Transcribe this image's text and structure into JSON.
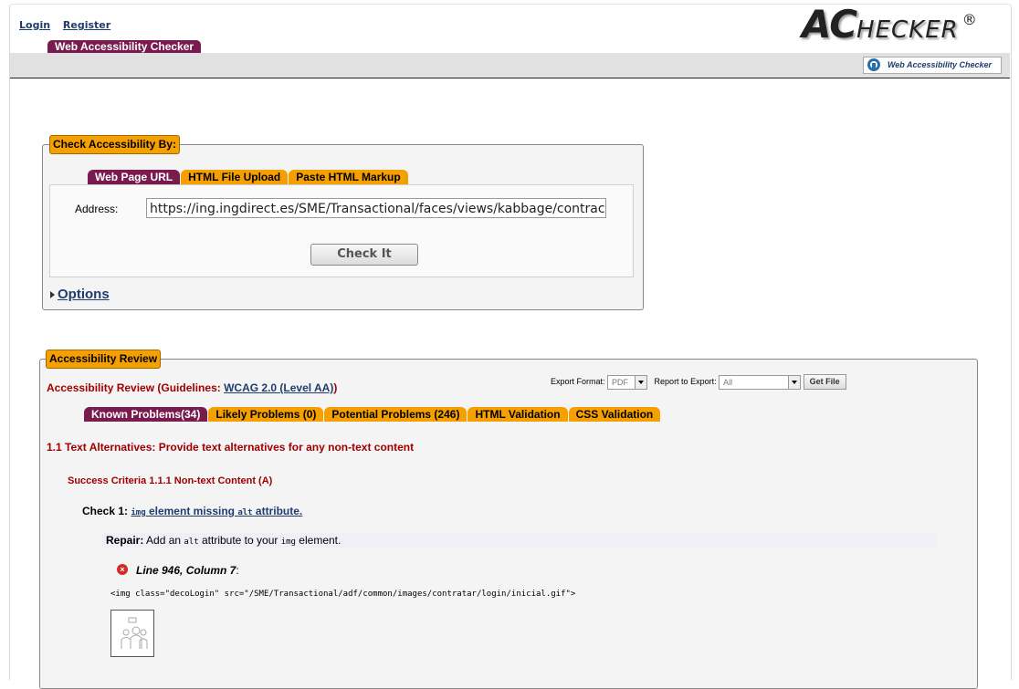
{
  "header": {
    "login": "Login",
    "register": "Register",
    "logo_ac": "AC",
    "logo_hecker": "HECKER",
    "logo_reg": "®",
    "main_tab": "Web Accessibility Checker",
    "help_button": "Web Accessibility Checker"
  },
  "check_form": {
    "legend": "Check Accessibility By:",
    "tabs": [
      "Web Page URL",
      "HTML File Upload",
      "Paste HTML Markup"
    ],
    "address_label": "Address:",
    "address_value": "https://ing.ingdirect.es/SME/Transactional/faces/views/kabbage/contract",
    "check_button": "Check It",
    "options_link": "Options"
  },
  "review": {
    "legend": "Accessibility Review",
    "title_prefix": "Accessibility Review (Guidelines: ",
    "guideline_link": "WCAG 2.0 (Level AA)",
    "title_suffix": ")",
    "export_format_label": "Export Format:",
    "export_format_value": "PDF",
    "report_label": "Report to Export:",
    "report_value": "All",
    "get_file": "Get File",
    "tabs": [
      "Known Problems(34)",
      "Likely Problems (0)",
      "Potential Problems (246)",
      "HTML Validation",
      "CSS Validation"
    ],
    "guideline_heading": "1.1 Text Alternatives: Provide text alternatives for any non-text content",
    "success_criteria": "Success Criteria 1.1.1 Non-text Content (A)",
    "check_label": "Check 1: ",
    "check_link_code1": "img",
    "check_link_text1": " element missing ",
    "check_link_code2": "alt",
    "check_link_text2": " attribute.",
    "repair_label": "Repair:",
    "repair_text1": " Add an ",
    "repair_code1": "alt",
    "repair_text2": " attribute to your ",
    "repair_code2": "img",
    "repair_text3": " element.",
    "error_location": "Line 946, Column 7",
    "error_colon": ":",
    "code_snippet": "<img class=\"decoLogin\" src=\"/SME/Transactional/adf/common/images/contratar/login/inicial.gif\">"
  }
}
